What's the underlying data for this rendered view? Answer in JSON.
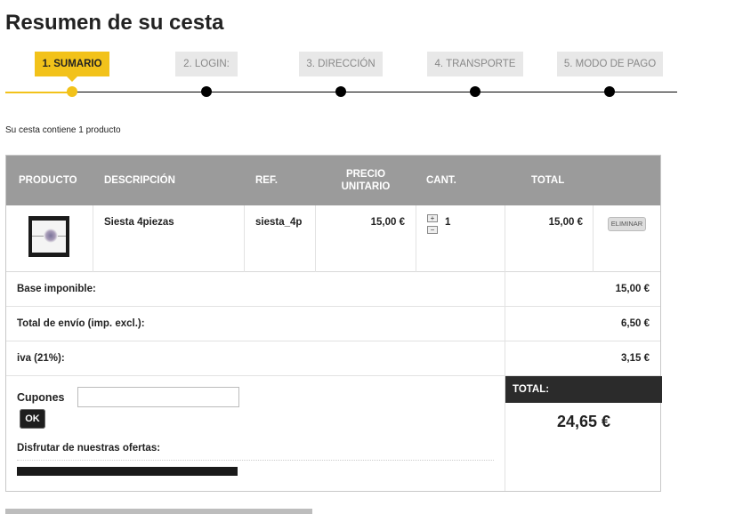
{
  "page": {
    "title": "Resumen de su cesta"
  },
  "steps": [
    {
      "label": "1. SUMARIO",
      "active": true
    },
    {
      "label": "2. LOGIN:",
      "active": false
    },
    {
      "label": "3. DIRECCIÓN",
      "active": false
    },
    {
      "label": "4. TRANSPORTE",
      "active": false
    },
    {
      "label": "5. MODO DE PAGO",
      "active": false
    }
  ],
  "cart": {
    "summary_text": "Su cesta contiene 1 producto",
    "headers": {
      "product": "PRODUCTO",
      "description": "DESCRIPCIÓN",
      "ref": "REF.",
      "unit_price_line1": "PRECIO",
      "unit_price_line2": "UNITARIO",
      "qty": "CANT.",
      "total": "TOTAL"
    },
    "items": [
      {
        "description": "Siesta 4piezas",
        "ref": "siesta_4p",
        "unit_price": "15,00 €",
        "qty": "1",
        "total": "15,00 €",
        "remove_label": "ELIMINAR",
        "qty_plus": "+",
        "qty_minus": "−"
      }
    ],
    "totals": [
      {
        "label": "Base imponible:",
        "value": "15,00 €"
      },
      {
        "label": "Total de envío (imp. excl.):",
        "value": "6,50 €"
      },
      {
        "label": "iva (21%):",
        "value": "3,15 €"
      }
    ],
    "coupon": {
      "label": "Cupones",
      "value": "",
      "ok_label": "OK"
    },
    "offers_label": "Disfrutar de nuestras ofertas:",
    "grand_total": {
      "label": "TOTAL:",
      "value": "24,65 €"
    }
  },
  "colors": {
    "accent": "#f2c21a",
    "header_bg": "#9b9b9b",
    "dark": "#2b2b2b"
  }
}
